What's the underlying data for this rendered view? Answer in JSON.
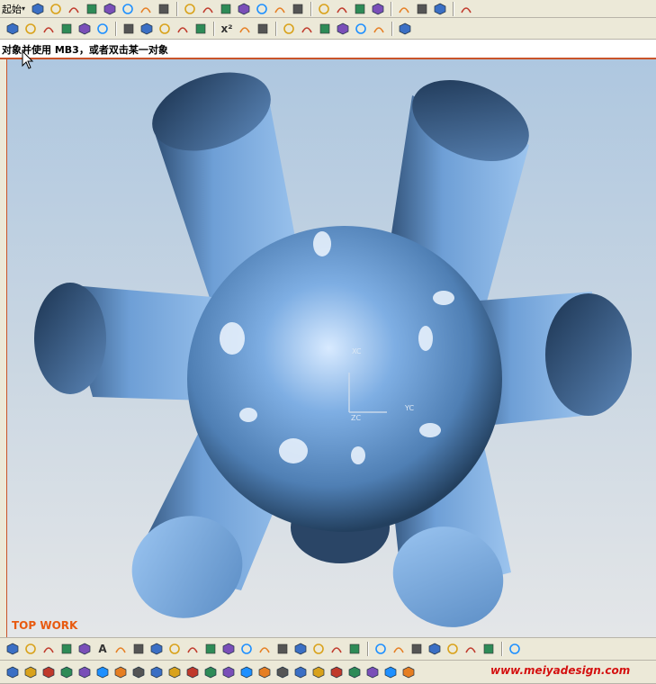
{
  "toolbar_top": {
    "start_label": "起始",
    "icons": [
      "new-file-icon",
      "open-file-icon",
      "save-icon",
      "cut-icon",
      "copy-icon",
      "paste-icon",
      "undo-icon",
      "brush-icon",
      "sep",
      "close-view-icon",
      "shade-icon",
      "fit-icon",
      "zoom-icon",
      "rotate-icon",
      "pan-icon",
      "layer-icon",
      "sep",
      "view-iso-icon",
      "view-front-icon",
      "view-top-icon",
      "view-right-icon",
      "sep",
      "sheet-icon",
      "measure-icon",
      "analysis-icon",
      "sep",
      "tools-icon"
    ]
  },
  "toolbar_second": {
    "icons": [
      "line-icon",
      "arc-icon",
      "point-icon",
      "circle-icon",
      "polygon-icon",
      "plus-icon",
      "sep",
      "feature-icon",
      "extrude-icon",
      "revolve-icon",
      "sweep-icon",
      "blend-icon",
      "sep",
      "expression-icon",
      "transform-icon",
      "move-icon",
      "sep",
      "curve-analysis-icon",
      "surface-analysis-icon",
      "section-icon",
      "offset-icon",
      "trim-icon",
      "edit-icon",
      "sep",
      "analysis-shape-icon"
    ],
    "expression_glyph": "x²"
  },
  "cue_line": {
    "text": "对象并使用 MB3，或者双击某一对象"
  },
  "viewport": {
    "view_label": "TOP WORK",
    "axes": {
      "x_label": "XC",
      "y_label": "YC",
      "z_label": "ZC"
    },
    "colors": {
      "model": "#6e9fd6",
      "model_dark": "#1f3a5c",
      "highlight": "#e6f2ff",
      "label": "#e85a10"
    }
  },
  "toolbar_bottom_1": {
    "icons": [
      "arc-tool-icon",
      "curve-tool-icon",
      "spline-icon",
      "studio-spline-icon",
      "helix-icon",
      "text-icon",
      "point-set-icon",
      "plus-point-icon",
      "fillet-icon",
      "rectangle-icon",
      "polygon-tool-icon",
      "ellipse-icon",
      "spiral-icon",
      "extract-icon",
      "law-curve-icon",
      "bridge-icon",
      "join-icon",
      "project-icon",
      "intersect-icon",
      "section-curve-icon",
      "sep",
      "wire-icon",
      "isoparam-icon",
      "face-icon",
      "mesh-icon",
      "shade-tool-icon",
      "lamp-icon",
      "paint-icon",
      "sep",
      "view-triad-icon"
    ],
    "text_glyph": "A"
  },
  "toolbar_bottom_2": {
    "icons": [
      "book-icon",
      "cube-a-icon",
      "cube-b-icon",
      "cube-c-icon",
      "cube-d-icon",
      "cube-e-icon",
      "cube-f-icon",
      "cube-g-icon",
      "cube-h-icon",
      "cube-i-icon",
      "cube-j-icon",
      "cube-k-icon",
      "cube-l-icon",
      "cube-m-icon",
      "cube-n-icon",
      "cube-o-icon",
      "cube-p-icon",
      "cube-q-icon",
      "cube-r-icon",
      "cube-s-icon",
      "cube-t-icon",
      "cube-u-icon",
      "cube-v-icon"
    ],
    "watermark": "www.meiyadesign.com"
  }
}
